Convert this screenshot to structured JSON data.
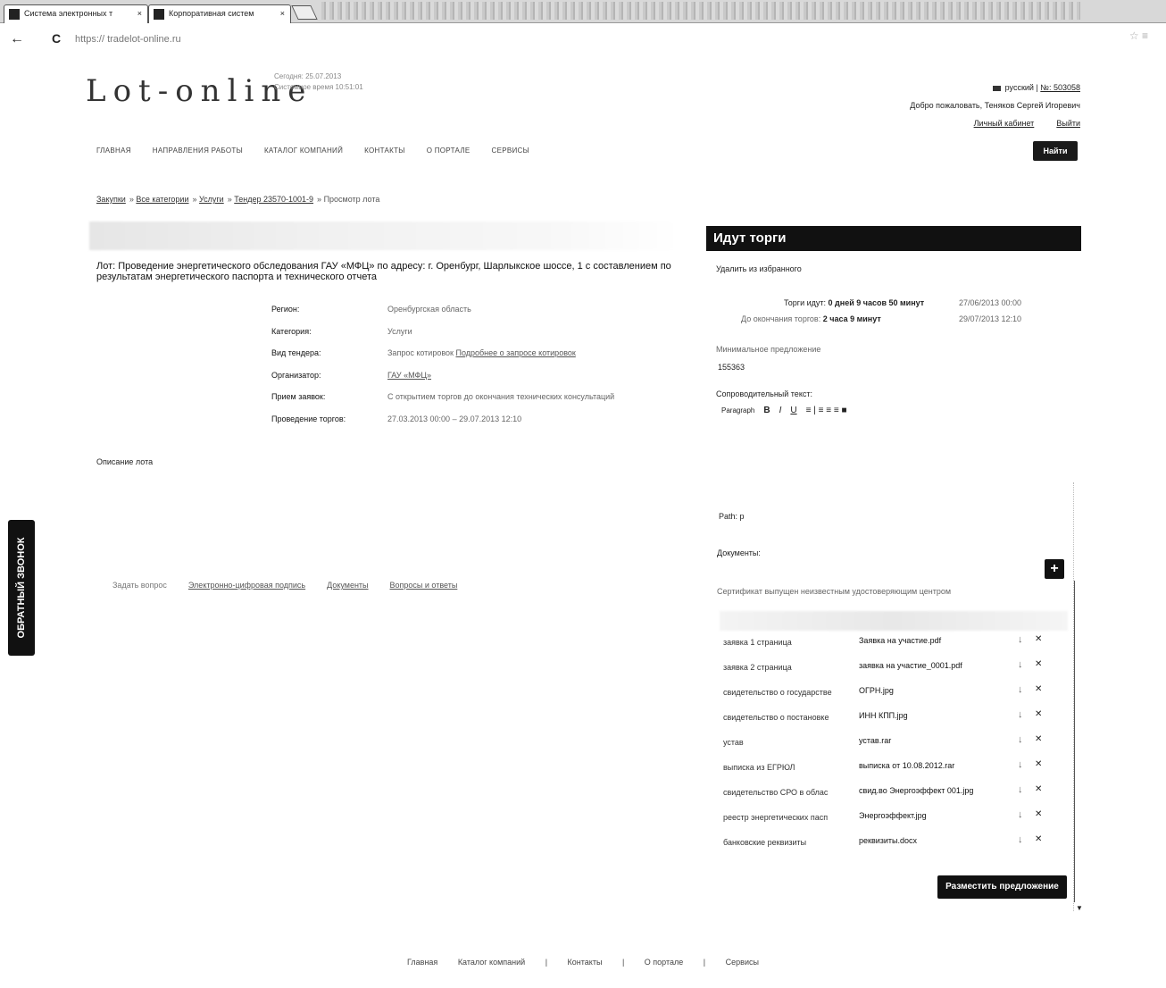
{
  "browser": {
    "tabs": [
      {
        "label": "Система электронных т"
      },
      {
        "label": "Корпоративная систем"
      }
    ],
    "tab_close": "×",
    "back_label": "←",
    "reload_label": "C",
    "url": "https:// tradelot-online.ru",
    "extensions": "☆ ≡"
  },
  "header": {
    "logo": "Lot-online",
    "logo_sub_line1": "Сегодня: 25.07.2013",
    "logo_sub_line2": "Системное время 10:51:01",
    "lang": "русский",
    "lk_no": "№: 503058",
    "welcome": "Добро пожаловать, Теняков Сергей Игоревич",
    "cabinet": "Личный кабинет",
    "logout": "Выйти",
    "find_button": "Найти"
  },
  "nav": {
    "items": [
      {
        "label": "ГЛАВНАЯ"
      },
      {
        "label": "НАПРАВЛЕНИЯ РАБОТЫ"
      },
      {
        "label": "КАТАЛОГ КОМПАНИЙ"
      },
      {
        "label": "КОНТАКТЫ"
      },
      {
        "label": "О ПОРТАЛЕ"
      },
      {
        "label": "СЕРВИСЫ"
      }
    ]
  },
  "breadcrumb": {
    "items": [
      {
        "label": "Закупки"
      },
      {
        "label": "Все категории"
      },
      {
        "label": "Услуги"
      },
      {
        "label": "Тендер 23570-1001-9"
      }
    ],
    "sep": "»",
    "current": "Просмотр лота"
  },
  "lot": {
    "title": "Лот: Проведение энергетического обследования ГАУ «МФЦ» по адресу: г. Оренбург, Шарлыкское шоссе, 1 с составлением по результатам энергетического паспорта и технического отчета",
    "fields": [
      {
        "label": "Регион:",
        "value": "Оренбургская область",
        "link": false
      },
      {
        "label": "Категория:",
        "value": "Услуги",
        "link": false
      },
      {
        "label": "Вид тендера:",
        "value": "Запрос котировок",
        "extra": "Подробнее о запросе котировок",
        "link": true
      },
      {
        "label": "Организатор:",
        "value": "ГАУ «МФЦ»",
        "link": true
      },
      {
        "label": "Прием заявок:",
        "value": "С открытием торгов до окончания технических консультаций",
        "link": false
      },
      {
        "label": "Проведение торгов:",
        "value": "27.03.2013 00:00 – 29.07.2013 12:10",
        "link": false
      }
    ],
    "description_label": "Описание лота"
  },
  "bottom_links": {
    "plain": "Задать вопрос",
    "links": [
      {
        "label": "Электронно-цифровая подпись"
      },
      {
        "label": "Документы"
      },
      {
        "label": "Вопросы и ответы"
      }
    ]
  },
  "callback": "ОБРАТНЫЙ ЗВОНОК",
  "auction": {
    "header": "Идут торги",
    "remove_fav": "Удалить из избранного",
    "time_left_label": "Торги идут:",
    "time_left": "0 дней 9 часов 50 минут",
    "time_left_date": "27/06/2013 00:00",
    "to_end_label": "До окончания торгов:",
    "to_end": "2 часа 9 минут",
    "to_end_date": "29/07/2013 12:10",
    "price_label": "Минимальное предложение",
    "price": "155363",
    "cover_text_label": "Сопроводительный текст:",
    "editor": {
      "format": "Paragraph",
      "bold": "B",
      "italic": "I",
      "underline": "U",
      "align_icons": "≡ | ≡ ≡ ≡ ■"
    },
    "path_label": "Path: p",
    "docs_label": "Документы:",
    "add_doc": "+",
    "cert_note": "Сертификат выпущен неизвестным удостоверяющим центром",
    "documents": [
      {
        "name": "заявка 1 страница",
        "file": "Заявка на участие.pdf"
      },
      {
        "name": "заявка 2 страница",
        "file": "заявка на участие_0001.pdf"
      },
      {
        "name": "свидетельство о государстве",
        "file": "ОГРН.jpg"
      },
      {
        "name": "свидетельство о постановке",
        "file": "ИНН КПП.jpg"
      },
      {
        "name": "устав",
        "file": "устав.rar"
      },
      {
        "name": "выписка из ЕГРЮЛ",
        "file": "выписка от 10.08.2012.rar"
      },
      {
        "name": "свидетельство СРО в облас",
        "file": "свид.во Энергоэффект 001.jpg"
      },
      {
        "name": "реестр энергетических пасп",
        "file": "Энергоэффект.jpg"
      },
      {
        "name": "банковские реквизиты",
        "file": "реквизиты.docx"
      }
    ],
    "download_icon": "↓",
    "delete_icon": "✕",
    "submit": "Разместить предложение"
  },
  "footer": {
    "items": [
      {
        "label": "Главная"
      },
      {
        "label": "Каталог компаний"
      },
      {
        "label": "Контакты"
      },
      {
        "label": "О портале"
      },
      {
        "label": "Сервисы"
      }
    ],
    "sep": "|"
  }
}
